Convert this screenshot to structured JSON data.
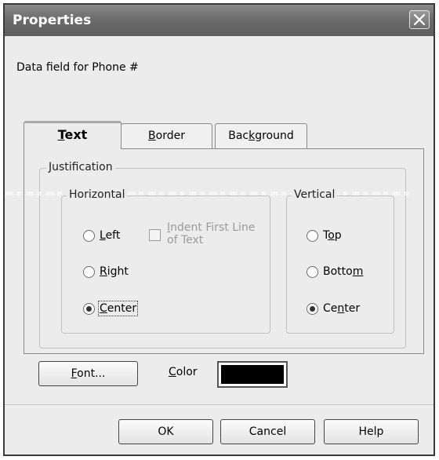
{
  "window": {
    "title": "Properties",
    "close_icon": "close-icon"
  },
  "field_label": "Data field for Phone #",
  "tabs": [
    {
      "label": "Text",
      "mnemonic": "T",
      "rest": "ext",
      "active": true
    },
    {
      "label": "Border",
      "mnemonic": "B",
      "rest": "order",
      "active": false
    },
    {
      "label": "Background",
      "pre": "Bac",
      "mnemonic": "k",
      "rest": "ground",
      "active": false
    }
  ],
  "justification": {
    "legend": "Justification",
    "horizontal": {
      "legend": "Horizontal",
      "options": [
        {
          "label": "Left",
          "mnemonic": "L",
          "rest": "eft",
          "checked": false
        },
        {
          "label": "Right",
          "mnemonic": "R",
          "rest": "ight",
          "checked": false
        },
        {
          "label": "Center",
          "mnemonic": "C",
          "rest": "enter",
          "checked": true
        }
      ],
      "indent_checkbox": {
        "line1_pre": "",
        "line1_mnemonic": "I",
        "line1_rest": "ndent First Line",
        "line2": "of Text",
        "checked": false,
        "enabled": false
      }
    },
    "vertical": {
      "legend": "Vertical",
      "options": [
        {
          "label": "Top",
          "pre": "T",
          "mnemonic": "o",
          "rest": "p",
          "checked": false
        },
        {
          "label": "Bottom",
          "pre": "Botto",
          "mnemonic": "m",
          "rest": "",
          "checked": false
        },
        {
          "label": "Center",
          "pre": "Ce",
          "mnemonic": "n",
          "rest": "ter",
          "checked": true
        }
      ]
    }
  },
  "font_button": {
    "label": "Font...",
    "mnemonic": "F",
    "rest": "ont..."
  },
  "color": {
    "label": "Color",
    "mnemonic": "C",
    "rest": "olor",
    "value": "#000000"
  },
  "buttons": {
    "ok": "OK",
    "cancel": "Cancel",
    "help": "Help"
  }
}
